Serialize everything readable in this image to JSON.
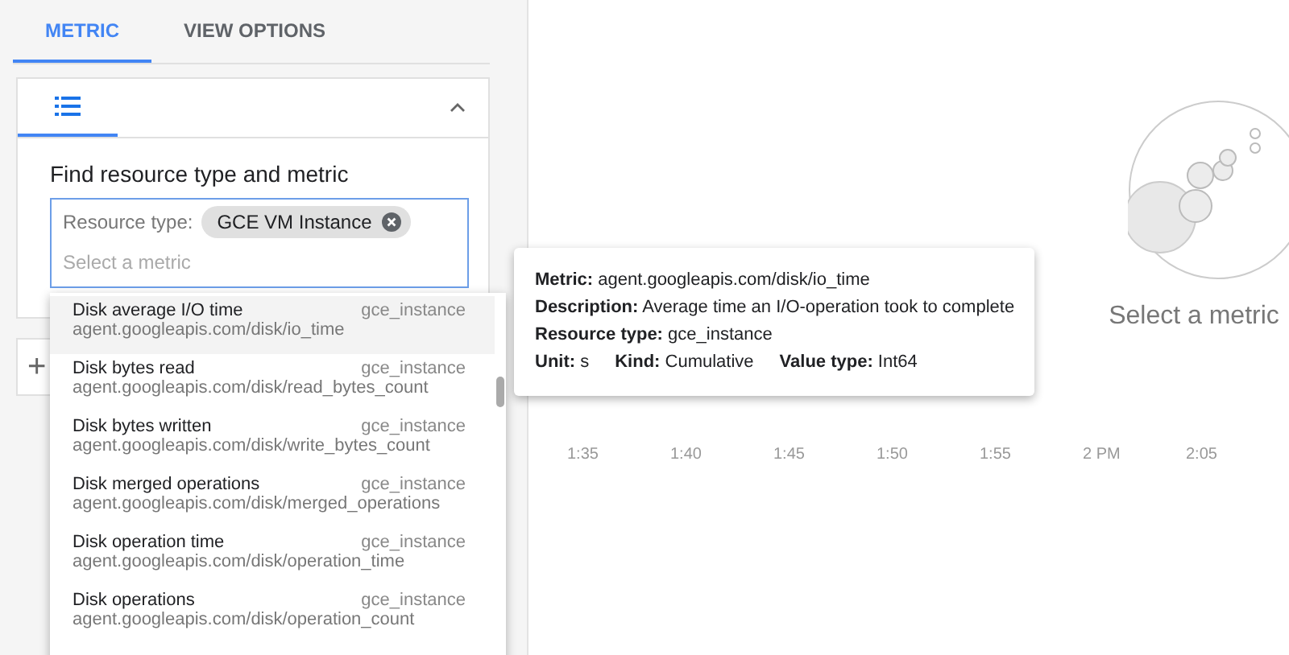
{
  "tabs": [
    {
      "label": "METRIC",
      "selected": true
    },
    {
      "label": "VIEW OPTIONS",
      "selected": false
    }
  ],
  "card": {
    "expanded": true,
    "heading": "Find resource type and metric",
    "resource_label": "Resource type:",
    "resource_chip": "GCE VM Instance",
    "placeholder": "Select a metric"
  },
  "add_button": "+",
  "dropdown": [
    {
      "name": "Disk average I/O time",
      "resource": "gce_instance",
      "path": "agent.googleapis.com/disk/io_time",
      "selected": true
    },
    {
      "name": "Disk bytes read",
      "resource": "gce_instance",
      "path": "agent.googleapis.com/disk/read_bytes_count",
      "selected": false
    },
    {
      "name": "Disk bytes written",
      "resource": "gce_instance",
      "path": "agent.googleapis.com/disk/write_bytes_count",
      "selected": false
    },
    {
      "name": "Disk merged operations",
      "resource": "gce_instance",
      "path": "agent.googleapis.com/disk/merged_operations",
      "selected": false
    },
    {
      "name": "Disk operation time",
      "resource": "gce_instance",
      "path": "agent.googleapis.com/disk/operation_time",
      "selected": false
    },
    {
      "name": "Disk operations",
      "resource": "gce_instance",
      "path": "agent.googleapis.com/disk/operation_count",
      "selected": false
    }
  ],
  "tooltip": {
    "lines": [
      "**Metric:** agent.googleapis.com/disk/io_time",
      "**Description:** Average time an I/O-operation took to complete",
      "**Resource type:** gce_instance"
    ],
    "facts": [
      "**Unit:** s",
      "**Kind:** Cumulative",
      "**Value type:** Int64"
    ]
  },
  "x_axis": [
    "1:35",
    "1:40",
    "1:45",
    "1:50",
    "1:55",
    "2 PM",
    "2:05"
  ],
  "empty_state": "Select a metric"
}
